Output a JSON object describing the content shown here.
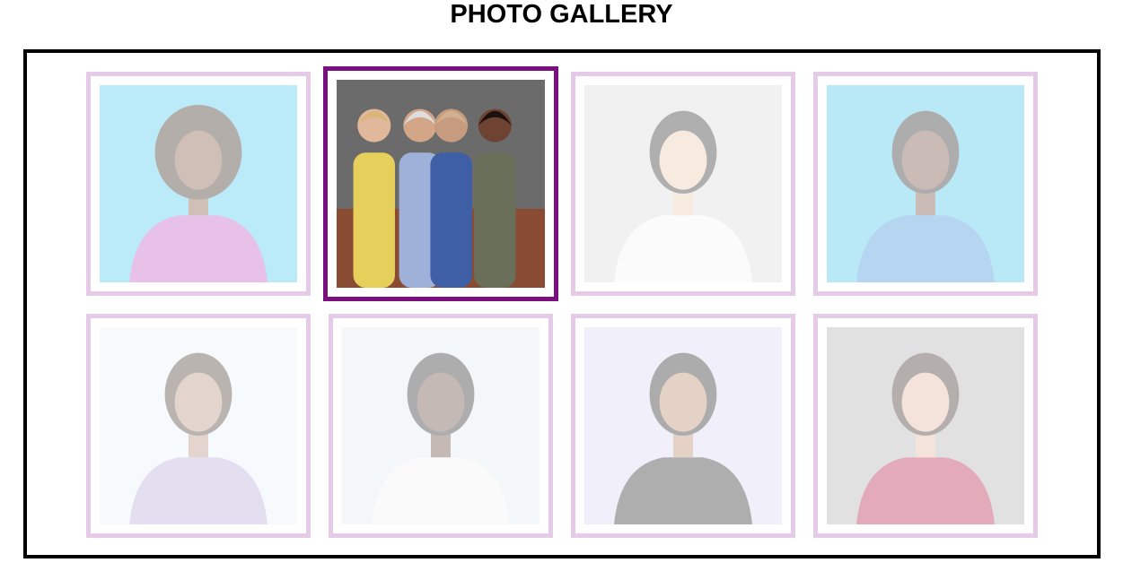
{
  "page": {
    "title": "PHOTO GALLERY"
  },
  "gallery": {
    "active_index": 1,
    "colors": {
      "frame": "#000000",
      "tile_border": "#e6cbe8",
      "tile_border_active": "#7b0f7f"
    },
    "photos": [
      {
        "name": "smiling-man-curly-hair-photo",
        "bg": "#3fc6ef",
        "skin": "#7a4a30",
        "hair": "#2b1a12",
        "shirt": "#c04fbf"
      },
      {
        "name": "people-meeting-handshake-photo",
        "bg": "#6b6b6b",
        "skin": "#c99a7a",
        "hair": "#dcdcdc",
        "shirt": "#a9b7d6"
      },
      {
        "name": "woman-white-coat-photo",
        "bg": "#d8d8d8",
        "skin": "#e9c7a9",
        "hair": "#1d1d1d",
        "shirt": "#f4f4f4"
      },
      {
        "name": "woman-using-phone-photo",
        "bg": "#38c3ea",
        "skin": "#6a4030",
        "hair": "#171717",
        "shirt": "#2f8ad8"
      },
      {
        "name": "person-standing-white-sky-photo",
        "bg": "#e7f3f7",
        "skin": "#b08a72",
        "hair": "#3a2a20",
        "shirt": "#b2a6d8"
      },
      {
        "name": "man-looking-up-photo",
        "bg": "#dfeaef",
        "skin": "#5a3a2a",
        "hair": "#181818",
        "shirt": "#f2f2f2"
      },
      {
        "name": "woman-portrait-colored-light-photo",
        "bg": "#d5d3f2",
        "skin": "#b57f5f",
        "hair": "#151515",
        "shirt": "#1a1a1a"
      },
      {
        "name": "woman-red-top-smiling-photo",
        "bg": "#aaaaaa",
        "skin": "#e0b29a",
        "hair": "#2b1a16",
        "shirt": "#b0123a"
      }
    ]
  }
}
